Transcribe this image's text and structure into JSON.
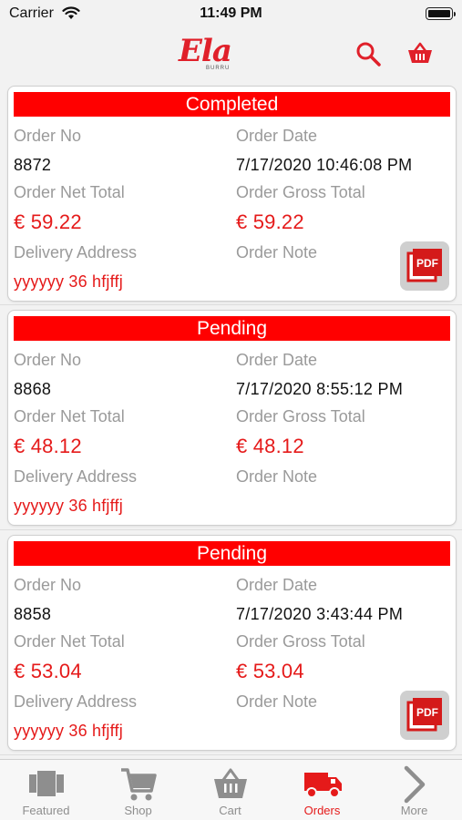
{
  "status_bar": {
    "carrier": "Carrier",
    "time": "11:49 PM"
  },
  "header": {
    "logo_text": "Ela",
    "logo_subtext": "BURRU",
    "brand_color": "#e0202a",
    "icons": [
      "search-icon",
      "basket-icon"
    ]
  },
  "orders": [
    {
      "status": "Completed",
      "order_no_label": "Order No",
      "order_no": "8872",
      "order_date_label": "Order Date",
      "order_date": "7/17/2020 10:46:08 PM",
      "net_total_label": "Order Net Total",
      "net_total": "€ 59.22",
      "gross_total_label": "Order Gross Total",
      "gross_total": "€ 59.22",
      "address_label": "Delivery Address",
      "address": "yyyyyy 36 hfjffj",
      "note_label": "Order Note",
      "note": "",
      "has_pdf": true
    },
    {
      "status": "Pending",
      "order_no_label": "Order No",
      "order_no": "8868",
      "order_date_label": "Order Date",
      "order_date": "7/17/2020 8:55:12 PM",
      "net_total_label": "Order Net Total",
      "net_total": "€ 48.12",
      "gross_total_label": "Order Gross Total",
      "gross_total": "€ 48.12",
      "address_label": "Delivery Address",
      "address": "yyyyyy 36 hfjffj",
      "note_label": "Order Note",
      "note": "",
      "has_pdf": false
    },
    {
      "status": "Pending",
      "order_no_label": "Order No",
      "order_no": "8858",
      "order_date_label": "Order Date",
      "order_date": "7/17/2020 3:43:44 PM",
      "net_total_label": "Order Net Total",
      "net_total": "€ 53.04",
      "gross_total_label": "Order Gross Total",
      "gross_total": "€ 53.04",
      "address_label": "Delivery Address",
      "address": "yyyyyy 36 hfjffj",
      "note_label": "Order Note",
      "note": "",
      "has_pdf": true
    }
  ],
  "pdf_label": "PDF",
  "tabs": [
    {
      "label": "Featured",
      "icon": "featured-icon",
      "active": false
    },
    {
      "label": "Shop",
      "icon": "cart-icon",
      "active": false
    },
    {
      "label": "Cart",
      "icon": "basket-icon",
      "active": false
    },
    {
      "label": "Orders",
      "icon": "truck-icon",
      "active": true
    },
    {
      "label": "More",
      "icon": "chevron-right-icon",
      "active": false
    }
  ],
  "colors": {
    "status_red": "#ff0000",
    "price_red": "#e51a1a",
    "active_tab": "#e51a1a",
    "inactive_tab": "#8e8e8e"
  }
}
